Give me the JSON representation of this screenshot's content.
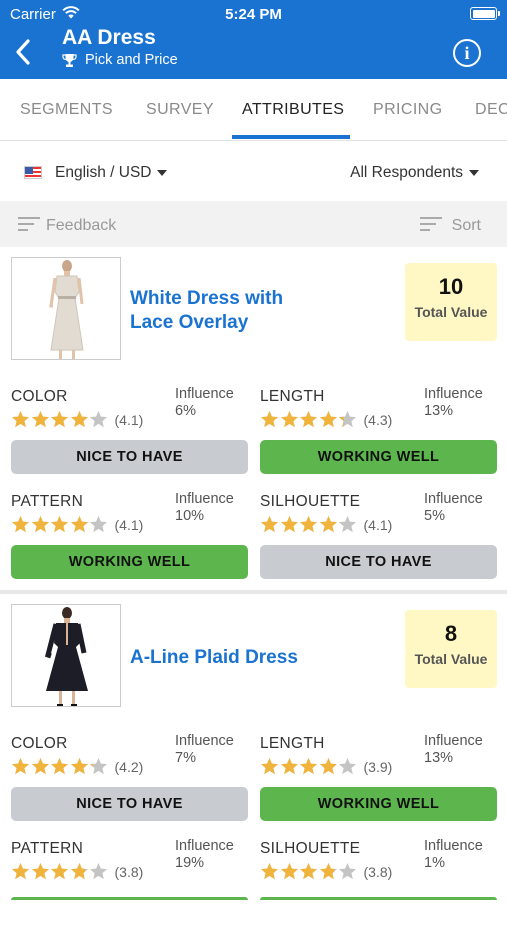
{
  "status": {
    "carrier": "Carrier",
    "time": "5:24 PM"
  },
  "header": {
    "title": "AA Dress",
    "subtitle": "Pick and Price"
  },
  "tabs": [
    "SEGMENTS",
    "SURVEY",
    "ATTRIBUTES",
    "PRICING",
    "DEC"
  ],
  "active_tab": "ATTRIBUTES",
  "filter": {
    "language": "English / USD",
    "respondents": "All Respondents"
  },
  "toolbar": {
    "feedback": "Feedback",
    "sort": "Sort"
  },
  "influence_label": "Influence",
  "total_value_label": "Total Value",
  "colors": {
    "brand": "#1a73d1",
    "working_well": "#5db54d",
    "nice_to_have": "#c8ccd0",
    "star": "#f0b43c",
    "total_value_bg": "#fff8c4"
  },
  "products": [
    {
      "name": "White Dress with Lace Overlay",
      "total_value": "10",
      "attributes": [
        {
          "name": "COLOR",
          "rating": 4.1,
          "rating_text": "(4.1)",
          "influence": "6%",
          "status": "NICE TO HAVE"
        },
        {
          "name": "LENGTH",
          "rating": 4.3,
          "rating_text": "(4.3)",
          "influence": "13%",
          "status": "WORKING WELL"
        },
        {
          "name": "PATTERN",
          "rating": 4.1,
          "rating_text": "(4.1)",
          "influence": "10%",
          "status": "WORKING WELL"
        },
        {
          "name": "SILHOUETTE",
          "rating": 4.1,
          "rating_text": "(4.1)",
          "influence": "5%",
          "status": "NICE TO HAVE"
        }
      ]
    },
    {
      "name": "A-Line Plaid Dress",
      "total_value": "8",
      "attributes": [
        {
          "name": "COLOR",
          "rating": 4.2,
          "rating_text": "(4.2)",
          "influence": "7%",
          "status": "NICE TO HAVE"
        },
        {
          "name": "LENGTH",
          "rating": 3.9,
          "rating_text": "(3.9)",
          "influence": "13%",
          "status": "WORKING WELL"
        },
        {
          "name": "PATTERN",
          "rating": 3.8,
          "rating_text": "(3.8)",
          "influence": "19%",
          "status": ""
        },
        {
          "name": "SILHOUETTE",
          "rating": 3.8,
          "rating_text": "(3.8)",
          "influence": "1%",
          "status": ""
        }
      ]
    }
  ]
}
